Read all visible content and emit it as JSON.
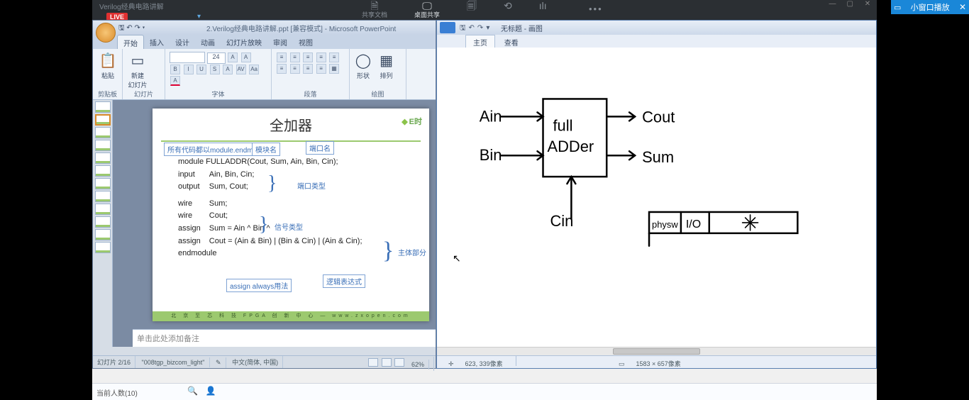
{
  "pip": {
    "label": "小窗口播放",
    "close": "✕"
  },
  "conf": {
    "title": "Verilog经典电路讲解",
    "live": "LIVE",
    "dropdown": "▾",
    "icons": [
      {
        "glyph": "🗎",
        "label": "共享文档"
      },
      {
        "glyph": "🖵",
        "label": "桌面共享"
      },
      {
        "glyph": "🗐",
        "label": ""
      },
      {
        "glyph": "⟲",
        "label": ""
      },
      {
        "glyph": "ılı",
        "label": ""
      }
    ],
    "more": "•••",
    "winbtns": [
      "—",
      "▢",
      "✕"
    ]
  },
  "ppt": {
    "qat": "🖫 ↶ ↷ ▾",
    "title": "2.Verilog经典电路讲解.ppt [兼容模式] - Microsoft PowerPoint",
    "tabs": [
      "开始",
      "插入",
      "设计",
      "动画",
      "幻灯片放映",
      "审阅",
      "视图"
    ],
    "active_tab": 0,
    "ribbon": {
      "groups": [
        "剪贴板",
        "幻灯片",
        "字体",
        "段落",
        "绘图"
      ],
      "paste": "粘贴",
      "newslide": "新建\n幻灯片",
      "font_size": "24",
      "shape": "形状",
      "arrange": "排列"
    },
    "slide": {
      "title": "全加器",
      "logo": "E时",
      "tags": {
        "a": "所有代码都以module.endmodule",
        "b": "模块名",
        "c": "端口名",
        "d": "端口类型",
        "e": "信号类型",
        "f": "主体部分",
        "g": "assign always用法",
        "h": "逻辑表达式"
      },
      "code": {
        "l1": "module FULLADDR(Cout, Sum, Ain, Bin, Cin);",
        "l2a": "input",
        "l2b": "Ain, Bin, Cin;",
        "l3a": "output",
        "l3b": "Sum, Cout;",
        "l4a": "wire",
        "l4b": "Sum;",
        "l5a": "wire",
        "l5b": "Cout;",
        "l6a": "assign",
        "l6b": "Sum = Ain ^ Bin ^ Cin;",
        "l7a": "assign",
        "l7b": "Cout = (Ain & Bin) | (Bin & Cin) | (Ain & Cin);",
        "l8": "endmodule"
      },
      "footer": "北 京 至 芯 科 技 FPGA 创 新 中 心 — www.zxopen.com"
    },
    "notes_placeholder": "单击此处添加备注",
    "status": {
      "slide": "幻灯片 2/16",
      "theme": "\"008tgp_bizcom_light\"",
      "lang": "中文(简体, 中国)",
      "zoom": "62%"
    }
  },
  "paint": {
    "title": "无标题 - 画图",
    "tabs": [
      "主页",
      "查看"
    ],
    "active_tab": 0,
    "diagram": {
      "ain": "Ain",
      "bin": "Bin",
      "cin": "Cin",
      "block1": "full",
      "block2": "ADDer",
      "cout": "Cout",
      "sum": "Sum",
      "plus": "+",
      "box_a": "physw",
      "box_b": "I/O"
    },
    "status": {
      "pos": "623, 339像素",
      "size": "1583 × 657像素"
    }
  },
  "bottom": {
    "count_label": "当前人数(10)",
    "search_glyph": "🔍",
    "mic_glyph": "👤"
  }
}
